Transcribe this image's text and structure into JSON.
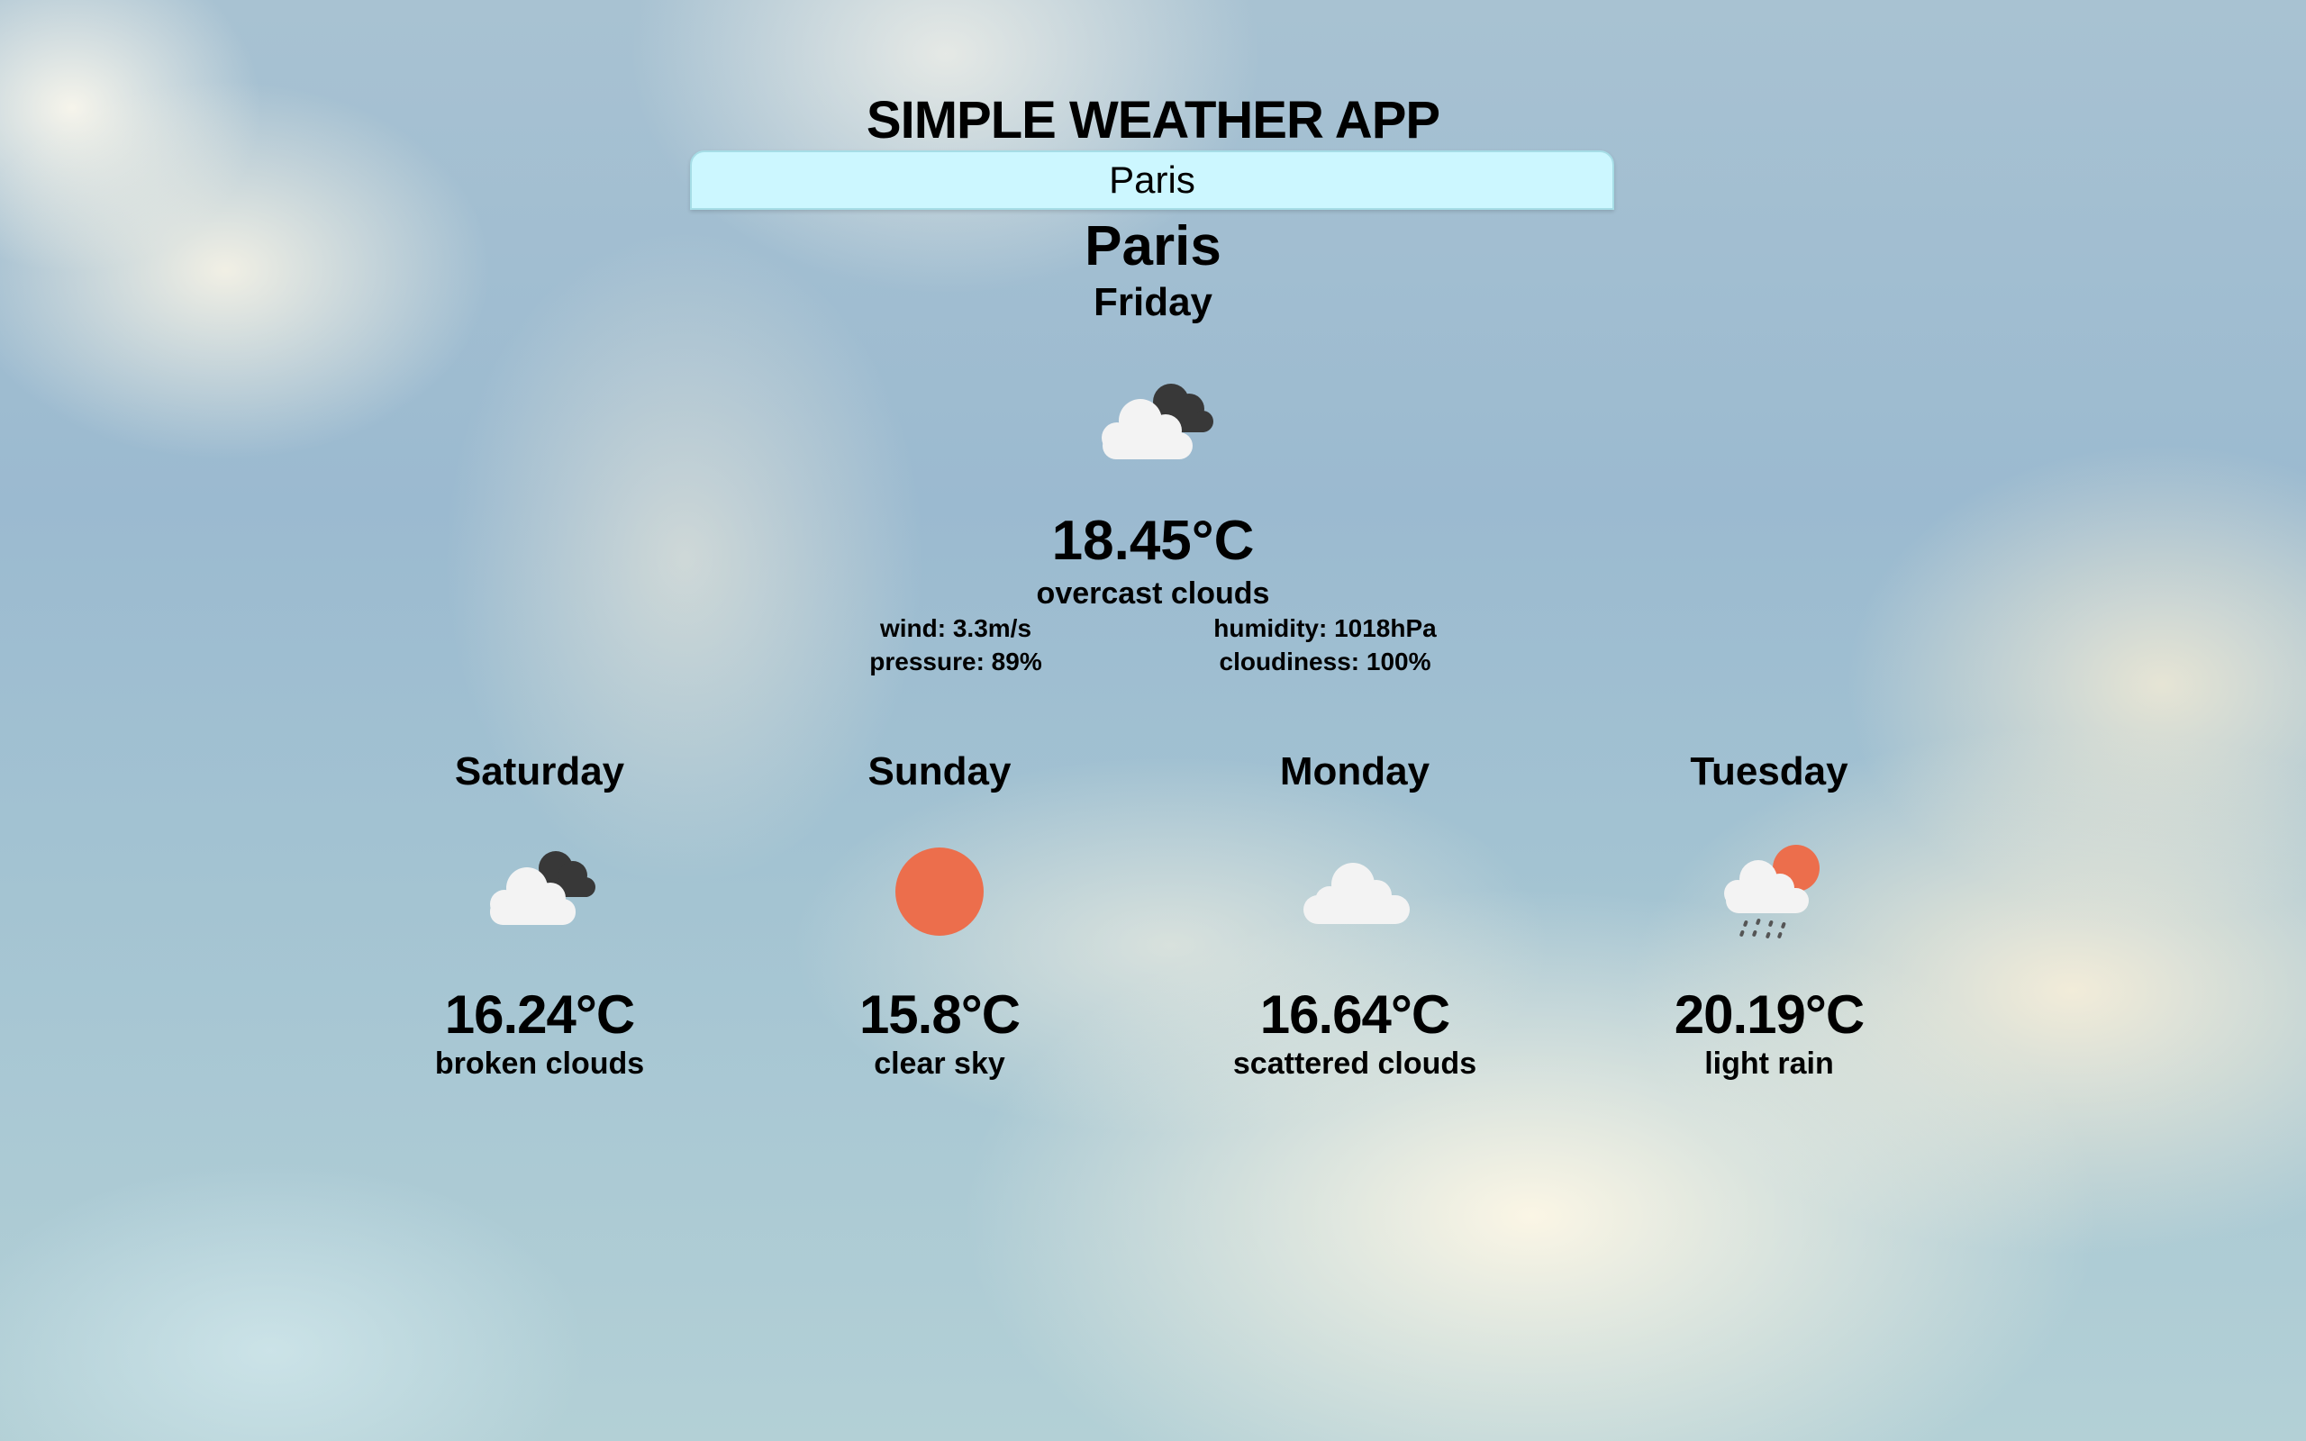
{
  "app": {
    "title": "SIMPLE WEATHER APP"
  },
  "search": {
    "value": "Paris"
  },
  "current": {
    "city": "Paris",
    "day": "Friday",
    "icon": "broken-clouds-icon",
    "temperature": "18.45°C",
    "description": "overcast clouds",
    "wind": "wind: 3.3m/s",
    "pressure": "pressure: 89%",
    "humidity": "humidity: 1018hPa",
    "cloudiness": "cloudiness: 100%"
  },
  "forecast": [
    {
      "day": "Saturday",
      "icon": "broken-clouds-icon",
      "temperature": "16.24°C",
      "description": "broken clouds"
    },
    {
      "day": "Sunday",
      "icon": "clear-sky-sun-icon",
      "temperature": "15.8°C",
      "description": "clear sky"
    },
    {
      "day": "Monday",
      "icon": "scattered-clouds-icon",
      "temperature": "16.64°C",
      "description": "scattered clouds"
    },
    {
      "day": "Tuesday",
      "icon": "light-rain-icon",
      "temperature": "20.19°C",
      "description": "light rain"
    }
  ],
  "colors": {
    "sun": "#ec6e4c",
    "cloud_light": "#f3f3f3",
    "cloud_dark": "#383838",
    "search_bg": "#ccf7ff"
  }
}
